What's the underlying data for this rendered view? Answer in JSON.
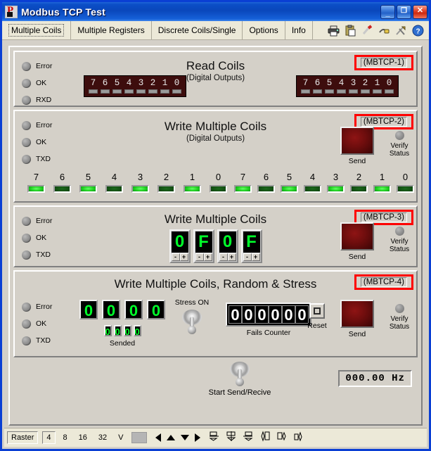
{
  "window": {
    "title": "Modbus TCP Test",
    "logo_icon": "app-logo-icon",
    "minimize_label": "_",
    "maximize_label": "❐",
    "close_label": "✕"
  },
  "tabs": [
    {
      "label": "Multiple Coils",
      "active": true
    },
    {
      "label": "Multiple Registers",
      "active": false
    },
    {
      "label": "Discrete Coils/Single",
      "active": false
    },
    {
      "label": "Options",
      "active": false
    },
    {
      "label": "Info",
      "active": false
    }
  ],
  "toolbar_icons": [
    "printer-icon",
    "clipboard-paste-icon",
    "screwdriver-icon",
    "plug-connector-icon",
    "tools-icon",
    "help-icon"
  ],
  "panels": [
    {
      "id": "read-coils",
      "title": "Read Coils",
      "subtitle": "(Digital Outputs)",
      "tag": "(MBTCP-1)",
      "leds": [
        {
          "label": "Error",
          "state": "off"
        },
        {
          "label": "OK",
          "state": "off"
        },
        {
          "label": "RXD",
          "state": "off"
        }
      ],
      "coil_bars": [
        {
          "bits": [
            "7",
            "6",
            "5",
            "4",
            "3",
            "2",
            "1",
            "0"
          ],
          "segments": [
            "off",
            "off",
            "off",
            "off",
            "off",
            "off",
            "off",
            "off"
          ]
        },
        {
          "bits": [
            "7",
            "6",
            "5",
            "4",
            "3",
            "2",
            "1",
            "0"
          ],
          "segments": [
            "off",
            "off",
            "off",
            "off",
            "off",
            "off",
            "off",
            "off"
          ]
        }
      ]
    },
    {
      "id": "write-multiple-coils-2",
      "title": "Write Multiple Coils",
      "subtitle": "(Digital Outputs)",
      "tag": "(MBTCP-2)",
      "leds": [
        {
          "label": "Error",
          "state": "off"
        },
        {
          "label": "OK",
          "state": "off"
        },
        {
          "label": "TXD",
          "state": "off"
        }
      ],
      "send_label": "Send",
      "verify_line1": "Verify",
      "verify_line2": "Status",
      "lamp_groups": [
        {
          "bits": [
            "7",
            "6",
            "5",
            "4",
            "3",
            "2",
            "1",
            "0"
          ],
          "states": [
            "on",
            "off",
            "on",
            "off",
            "on",
            "off",
            "on",
            "off"
          ]
        },
        {
          "bits": [
            "7",
            "6",
            "5",
            "4",
            "3",
            "2",
            "1",
            "0"
          ],
          "states": [
            "on",
            "off",
            "on",
            "off",
            "on",
            "off",
            "on",
            "off"
          ]
        }
      ]
    },
    {
      "id": "write-multiple-coils-3",
      "title": "Write Multiple Coils",
      "tag": "(MBTCP-3)",
      "leds": [
        {
          "label": "Error",
          "state": "off"
        },
        {
          "label": "OK",
          "state": "off"
        },
        {
          "label": "TXD",
          "state": "off"
        }
      ],
      "hex_digits": [
        "0",
        "F",
        "0",
        "F"
      ],
      "spin_down": "-",
      "spin_up": "+",
      "send_label": "Send",
      "verify_line1": "Verify",
      "verify_line2": "Status"
    },
    {
      "id": "write-multiple-coils-random-stress",
      "title": "Write Multiple Coils, Random & Stress",
      "tag": "(MBTCP-4)",
      "leds": [
        {
          "label": "Error",
          "state": "off"
        },
        {
          "label": "OK",
          "state": "off"
        },
        {
          "label": "TXD",
          "state": "off"
        }
      ],
      "value_digits": [
        "0",
        "0",
        "0",
        "0"
      ],
      "sended_digits": [
        "0",
        "0",
        "0",
        "0"
      ],
      "sended_label": "Sended",
      "stress_label": "Stress ON",
      "stress_state": "off",
      "fails_digits": [
        "0",
        "0",
        "0",
        "0",
        "0",
        "0"
      ],
      "fails_label": "Fails Counter",
      "reset_label": "Reset",
      "send_label": "Send",
      "verify_line1": "Verify",
      "verify_line2": "Status"
    }
  ],
  "footer": {
    "start_toggle_label": "Start Send/Recive",
    "start_toggle_state": "off",
    "hz_value": "000.00  Hz"
  },
  "statusbar": {
    "raster_label": "Raster",
    "sizes": [
      "4",
      "8",
      "16",
      "32"
    ],
    "active_size": "4",
    "v_label": "V",
    "color_swatch": "#b5b5b5",
    "arrow_icons": [
      "arrow-left-icon",
      "arrow-up-icon",
      "arrow-down-icon",
      "arrow-right-icon"
    ],
    "align_icons": [
      "align-left-icon",
      "align-center-icon",
      "align-right-icon",
      "align-top-icon",
      "align-middle-icon",
      "align-bottom-icon"
    ]
  },
  "colors": {
    "accent_red": "#ff0000",
    "lamp_on": "#1fd11f",
    "lamp_off": "#145214",
    "digit_green": "#00ff2a",
    "send_button": "#6d0d0d",
    "title_bar": "#0a47bb"
  }
}
